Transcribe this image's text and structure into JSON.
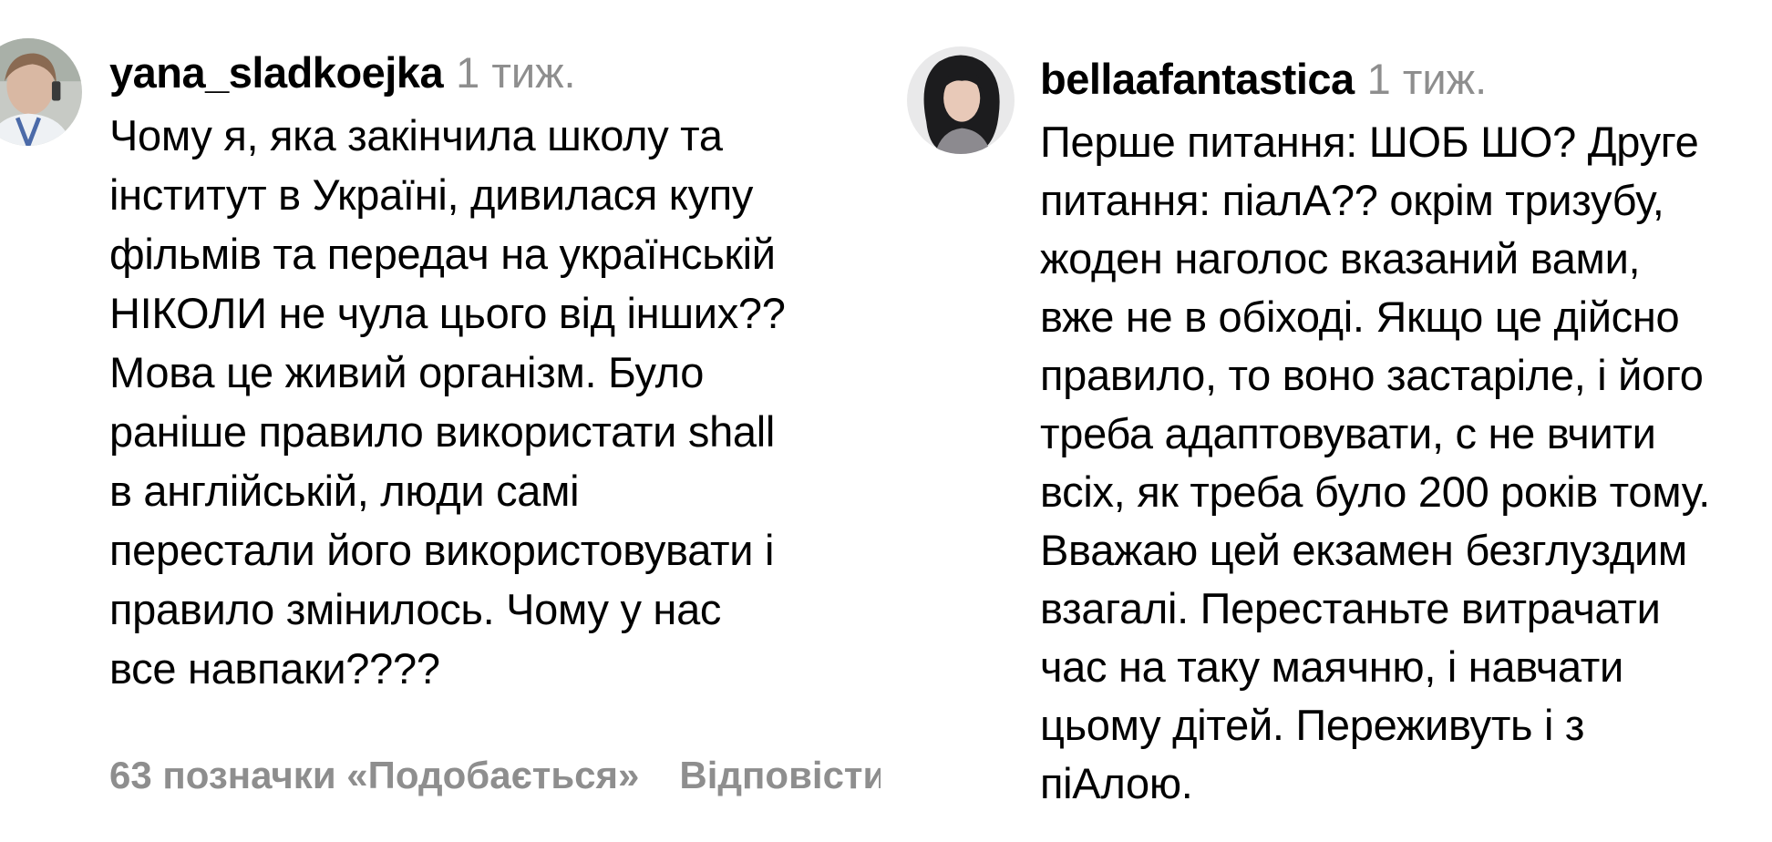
{
  "comments": [
    {
      "username": "yana_sladkoejka",
      "time": "1 тиж.",
      "text": "Чому я, яка закінчила школу та\nінститут в Україні, дивилася купу\nфільмів та передач на українській\nНІКОЛИ не чула цього від інших??\nМова це живий організм. Було\nраніше правило використати shall\nв англійській, люди самі\nперестали його використовувати і\nправило змінилось. Чому у нас\nвсе навпаки????",
      "likes_label": "63 позначки «Подобається»",
      "reply_label": "Відповісти"
    },
    {
      "username": "bellaafantastica",
      "time": "1 тиж.",
      "text": "Перше питання: ШОБ ШО? Друге\nпитання: піалА?? окрім тризубу,\nжоден наголос вказаний вами,\nвже не в обіході. Якщо це дійсно\nправило, то воно застаріле, і його\nтреба адаптовувати, с не вчити\nвсіх, як треба було 200 років тому.\nВважаю цей екзамен безглуздим\nвзагалі. Перестаньте витрачати\nчас на таку маячню, і навчати\nцьому дітей. Переживуть і з\nпіАлою."
    }
  ],
  "colors": {
    "text": "#000000",
    "muted": "#8e8e8e",
    "background": "#ffffff"
  }
}
